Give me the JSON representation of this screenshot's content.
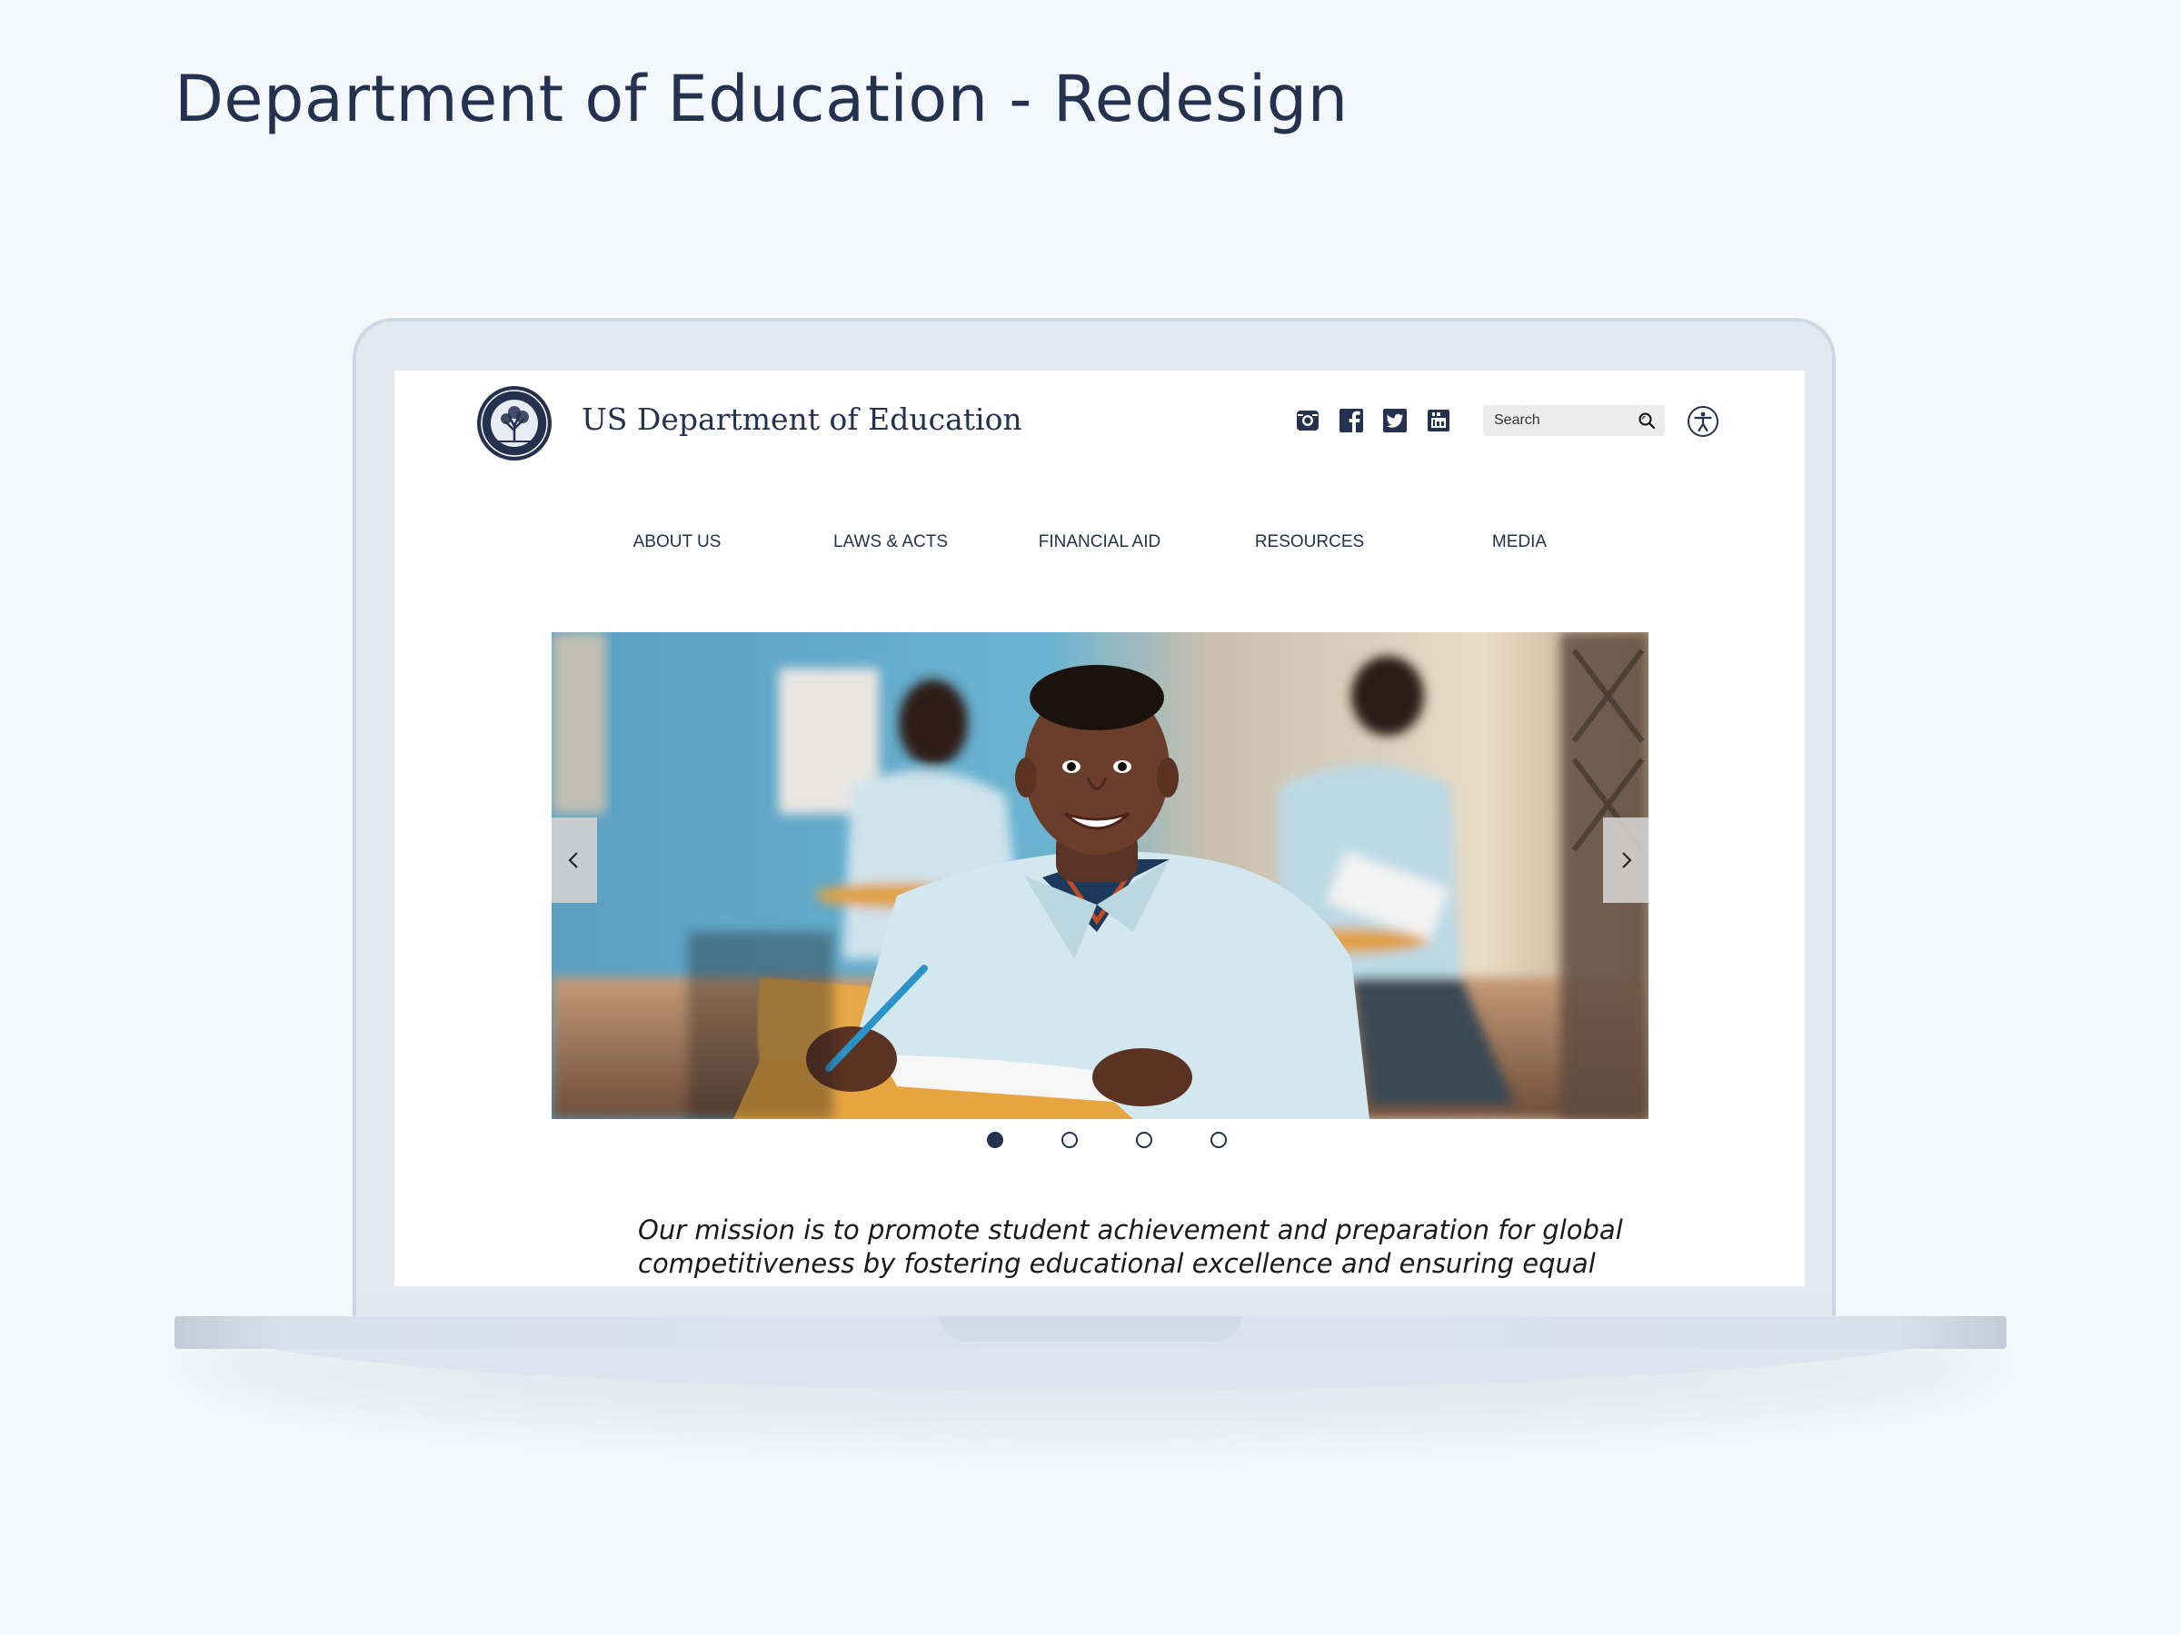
{
  "page": {
    "title": "Department of Education - Redesign"
  },
  "site": {
    "brand_name": "US Department of Education",
    "social_icons": [
      "instagram-icon",
      "facebook-icon",
      "twitter-icon",
      "youtube-icon"
    ],
    "search": {
      "placeholder": "Search"
    },
    "nav": [
      {
        "label": "ABOUT US"
      },
      {
        "label": "LAWS & ACTS"
      },
      {
        "label": "FINANCIAL AID"
      },
      {
        "label": "RESOURCES"
      },
      {
        "label": "MEDIA"
      }
    ],
    "carousel": {
      "slide_count": 4,
      "active_index": 0
    },
    "mission_line1": "Our mission is to promote student achievement and preparation for global",
    "mission_line2": "competitiveness by fostering educational excellence and ensuring equal access."
  },
  "colors": {
    "brand_navy": "#24324f",
    "background": "#f5f8fb",
    "laptop_frame": "#e2e8f0"
  }
}
